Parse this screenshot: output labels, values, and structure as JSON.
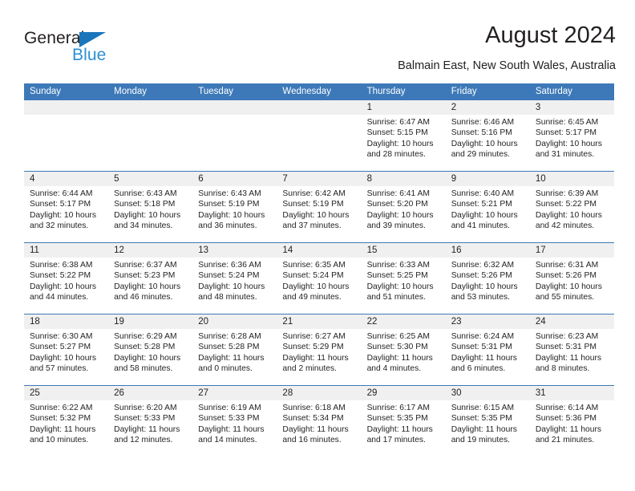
{
  "brand": {
    "name_dark": "General",
    "name_blue": "Blue",
    "accent_blue": "#1b75bb",
    "light_blue": "#2a8fd4"
  },
  "header": {
    "title": "August 2024",
    "subtitle": "Balmain East, New South Wales, Australia"
  },
  "calendar": {
    "header_bg": "#3d79b8",
    "day_band_bg": "#f0f0f0",
    "weekdays": [
      "Sunday",
      "Monday",
      "Tuesday",
      "Wednesday",
      "Thursday",
      "Friday",
      "Saturday"
    ],
    "weeks": [
      [
        {
          "day": "",
          "sunrise": "",
          "sunset": "",
          "daylight1": "",
          "daylight2": ""
        },
        {
          "day": "",
          "sunrise": "",
          "sunset": "",
          "daylight1": "",
          "daylight2": ""
        },
        {
          "day": "",
          "sunrise": "",
          "sunset": "",
          "daylight1": "",
          "daylight2": ""
        },
        {
          "day": "",
          "sunrise": "",
          "sunset": "",
          "daylight1": "",
          "daylight2": ""
        },
        {
          "day": "1",
          "sunrise": "Sunrise: 6:47 AM",
          "sunset": "Sunset: 5:15 PM",
          "daylight1": "Daylight: 10 hours",
          "daylight2": "and 28 minutes."
        },
        {
          "day": "2",
          "sunrise": "Sunrise: 6:46 AM",
          "sunset": "Sunset: 5:16 PM",
          "daylight1": "Daylight: 10 hours",
          "daylight2": "and 29 minutes."
        },
        {
          "day": "3",
          "sunrise": "Sunrise: 6:45 AM",
          "sunset": "Sunset: 5:17 PM",
          "daylight1": "Daylight: 10 hours",
          "daylight2": "and 31 minutes."
        }
      ],
      [
        {
          "day": "4",
          "sunrise": "Sunrise: 6:44 AM",
          "sunset": "Sunset: 5:17 PM",
          "daylight1": "Daylight: 10 hours",
          "daylight2": "and 32 minutes."
        },
        {
          "day": "5",
          "sunrise": "Sunrise: 6:43 AM",
          "sunset": "Sunset: 5:18 PM",
          "daylight1": "Daylight: 10 hours",
          "daylight2": "and 34 minutes."
        },
        {
          "day": "6",
          "sunrise": "Sunrise: 6:43 AM",
          "sunset": "Sunset: 5:19 PM",
          "daylight1": "Daylight: 10 hours",
          "daylight2": "and 36 minutes."
        },
        {
          "day": "7",
          "sunrise": "Sunrise: 6:42 AM",
          "sunset": "Sunset: 5:19 PM",
          "daylight1": "Daylight: 10 hours",
          "daylight2": "and 37 minutes."
        },
        {
          "day": "8",
          "sunrise": "Sunrise: 6:41 AM",
          "sunset": "Sunset: 5:20 PM",
          "daylight1": "Daylight: 10 hours",
          "daylight2": "and 39 minutes."
        },
        {
          "day": "9",
          "sunrise": "Sunrise: 6:40 AM",
          "sunset": "Sunset: 5:21 PM",
          "daylight1": "Daylight: 10 hours",
          "daylight2": "and 41 minutes."
        },
        {
          "day": "10",
          "sunrise": "Sunrise: 6:39 AM",
          "sunset": "Sunset: 5:22 PM",
          "daylight1": "Daylight: 10 hours",
          "daylight2": "and 42 minutes."
        }
      ],
      [
        {
          "day": "11",
          "sunrise": "Sunrise: 6:38 AM",
          "sunset": "Sunset: 5:22 PM",
          "daylight1": "Daylight: 10 hours",
          "daylight2": "and 44 minutes."
        },
        {
          "day": "12",
          "sunrise": "Sunrise: 6:37 AM",
          "sunset": "Sunset: 5:23 PM",
          "daylight1": "Daylight: 10 hours",
          "daylight2": "and 46 minutes."
        },
        {
          "day": "13",
          "sunrise": "Sunrise: 6:36 AM",
          "sunset": "Sunset: 5:24 PM",
          "daylight1": "Daylight: 10 hours",
          "daylight2": "and 48 minutes."
        },
        {
          "day": "14",
          "sunrise": "Sunrise: 6:35 AM",
          "sunset": "Sunset: 5:24 PM",
          "daylight1": "Daylight: 10 hours",
          "daylight2": "and 49 minutes."
        },
        {
          "day": "15",
          "sunrise": "Sunrise: 6:33 AM",
          "sunset": "Sunset: 5:25 PM",
          "daylight1": "Daylight: 10 hours",
          "daylight2": "and 51 minutes."
        },
        {
          "day": "16",
          "sunrise": "Sunrise: 6:32 AM",
          "sunset": "Sunset: 5:26 PM",
          "daylight1": "Daylight: 10 hours",
          "daylight2": "and 53 minutes."
        },
        {
          "day": "17",
          "sunrise": "Sunrise: 6:31 AM",
          "sunset": "Sunset: 5:26 PM",
          "daylight1": "Daylight: 10 hours",
          "daylight2": "and 55 minutes."
        }
      ],
      [
        {
          "day": "18",
          "sunrise": "Sunrise: 6:30 AM",
          "sunset": "Sunset: 5:27 PM",
          "daylight1": "Daylight: 10 hours",
          "daylight2": "and 57 minutes."
        },
        {
          "day": "19",
          "sunrise": "Sunrise: 6:29 AM",
          "sunset": "Sunset: 5:28 PM",
          "daylight1": "Daylight: 10 hours",
          "daylight2": "and 58 minutes."
        },
        {
          "day": "20",
          "sunrise": "Sunrise: 6:28 AM",
          "sunset": "Sunset: 5:28 PM",
          "daylight1": "Daylight: 11 hours",
          "daylight2": "and 0 minutes."
        },
        {
          "day": "21",
          "sunrise": "Sunrise: 6:27 AM",
          "sunset": "Sunset: 5:29 PM",
          "daylight1": "Daylight: 11 hours",
          "daylight2": "and 2 minutes."
        },
        {
          "day": "22",
          "sunrise": "Sunrise: 6:25 AM",
          "sunset": "Sunset: 5:30 PM",
          "daylight1": "Daylight: 11 hours",
          "daylight2": "and 4 minutes."
        },
        {
          "day": "23",
          "sunrise": "Sunrise: 6:24 AM",
          "sunset": "Sunset: 5:31 PM",
          "daylight1": "Daylight: 11 hours",
          "daylight2": "and 6 minutes."
        },
        {
          "day": "24",
          "sunrise": "Sunrise: 6:23 AM",
          "sunset": "Sunset: 5:31 PM",
          "daylight1": "Daylight: 11 hours",
          "daylight2": "and 8 minutes."
        }
      ],
      [
        {
          "day": "25",
          "sunrise": "Sunrise: 6:22 AM",
          "sunset": "Sunset: 5:32 PM",
          "daylight1": "Daylight: 11 hours",
          "daylight2": "and 10 minutes."
        },
        {
          "day": "26",
          "sunrise": "Sunrise: 6:20 AM",
          "sunset": "Sunset: 5:33 PM",
          "daylight1": "Daylight: 11 hours",
          "daylight2": "and 12 minutes."
        },
        {
          "day": "27",
          "sunrise": "Sunrise: 6:19 AM",
          "sunset": "Sunset: 5:33 PM",
          "daylight1": "Daylight: 11 hours",
          "daylight2": "and 14 minutes."
        },
        {
          "day": "28",
          "sunrise": "Sunrise: 6:18 AM",
          "sunset": "Sunset: 5:34 PM",
          "daylight1": "Daylight: 11 hours",
          "daylight2": "and 16 minutes."
        },
        {
          "day": "29",
          "sunrise": "Sunrise: 6:17 AM",
          "sunset": "Sunset: 5:35 PM",
          "daylight1": "Daylight: 11 hours",
          "daylight2": "and 17 minutes."
        },
        {
          "day": "30",
          "sunrise": "Sunrise: 6:15 AM",
          "sunset": "Sunset: 5:35 PM",
          "daylight1": "Daylight: 11 hours",
          "daylight2": "and 19 minutes."
        },
        {
          "day": "31",
          "sunrise": "Sunrise: 6:14 AM",
          "sunset": "Sunset: 5:36 PM",
          "daylight1": "Daylight: 11 hours",
          "daylight2": "and 21 minutes."
        }
      ]
    ]
  }
}
